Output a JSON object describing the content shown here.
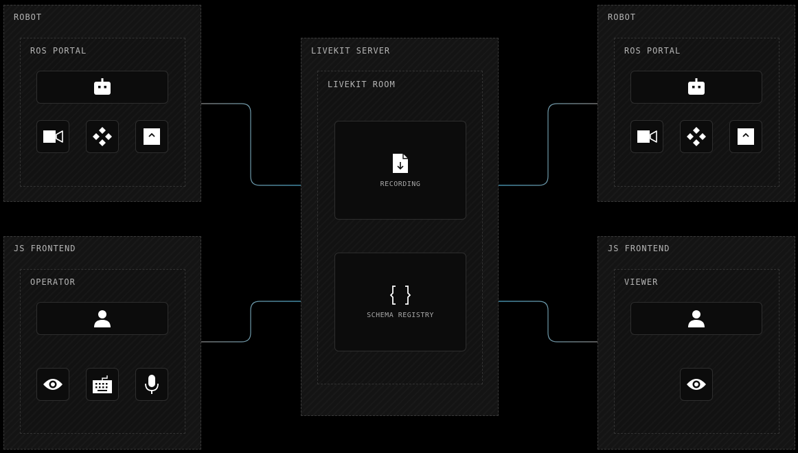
{
  "robot_left": {
    "title": "ROBOT",
    "subtitle": "ROS PORTAL",
    "icons": [
      "robot-icon",
      "video-camera-icon",
      "gamepad-icon",
      "caret-up-icon"
    ]
  },
  "frontend_left": {
    "title": "JS FRONTEND",
    "subtitle": "OPERATOR",
    "icons": [
      "user-icon",
      "eye-icon",
      "keyboard-icon",
      "microphone-icon"
    ]
  },
  "server": {
    "title": "LIVEKIT SERVER",
    "room": {
      "title": "LIVEKIT ROOM",
      "recording": {
        "label": "RECORDING",
        "icon": "file-download-icon"
      },
      "schema_registry": {
        "label": "SCHEMA REGISTRY",
        "icon": "braces-icon"
      }
    }
  },
  "robot_right": {
    "title": "ROBOT",
    "subtitle": "ROS PORTAL",
    "icons": [
      "robot-icon",
      "video-camera-icon",
      "gamepad-icon",
      "caret-up-icon"
    ]
  },
  "frontend_right": {
    "title": "JS FRONTEND",
    "subtitle": "VIEWER",
    "icons": [
      "user-icon",
      "eye-icon"
    ]
  },
  "colors": {
    "connector_gray": "#8a8a8a",
    "connector_accent": "#4fa7c9",
    "background": "#000000",
    "panel": "#141414"
  }
}
